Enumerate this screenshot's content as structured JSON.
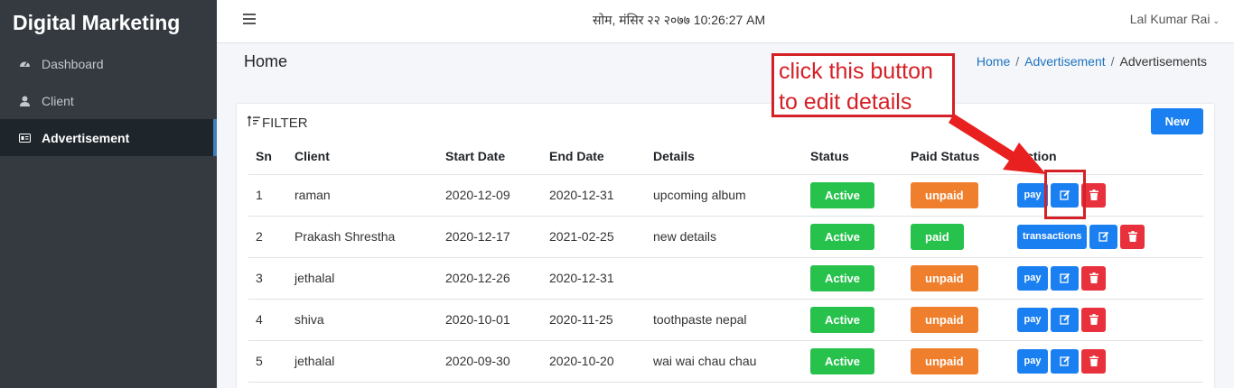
{
  "sidebar": {
    "brand": "Digital Marketing",
    "items": [
      {
        "label": "Dashboard",
        "icon": "dashboard-icon"
      },
      {
        "label": "Client",
        "icon": "user-icon"
      },
      {
        "label": "Advertisement",
        "icon": "ad-icon",
        "active": true
      }
    ]
  },
  "topbar": {
    "datetime": "सोम, मंसिर २२ २०७७ 10:26:27 AM",
    "user": "Lal Kumar Rai"
  },
  "page": {
    "title": "Home",
    "breadcrumb": [
      "Home",
      "Advertisement",
      "Advertisements"
    ]
  },
  "card": {
    "filter_label": "FILTER",
    "new_button": "New"
  },
  "table": {
    "headers": [
      "Sn",
      "Client",
      "Start Date",
      "End Date",
      "Details",
      "Status",
      "Paid Status",
      "Action"
    ],
    "rows": [
      {
        "sn": "1",
        "client": "raman",
        "start": "2020-12-09",
        "end": "2020-12-31",
        "details": "upcoming album",
        "status": "Active",
        "paid": "unpaid",
        "primary_action": "pay"
      },
      {
        "sn": "2",
        "client": "Prakash Shrestha",
        "start": "2020-12-17",
        "end": "2021-02-25",
        "details": "new details",
        "status": "Active",
        "paid": "paid",
        "primary_action": "transactions"
      },
      {
        "sn": "3",
        "client": "jethalal",
        "start": "2020-12-26",
        "end": "2020-12-31",
        "details": "",
        "status": "Active",
        "paid": "unpaid",
        "primary_action": "pay"
      },
      {
        "sn": "4",
        "client": "shiva",
        "start": "2020-10-01",
        "end": "2020-11-25",
        "details": "toothpaste nepal",
        "status": "Active",
        "paid": "unpaid",
        "primary_action": "pay"
      },
      {
        "sn": "5",
        "client": "jethalal",
        "start": "2020-09-30",
        "end": "2020-10-20",
        "details": "wai wai chau chau",
        "status": "Active",
        "paid": "unpaid",
        "primary_action": "pay"
      }
    ]
  },
  "annotation": {
    "line1": "click this button",
    "line2": "to edit details"
  },
  "colors": {
    "primary": "#1a7ff0",
    "success": "#27c24c",
    "warning": "#f07f2d",
    "danger": "#e8313c",
    "annotation": "#d42027",
    "sidebar": "#343a40"
  }
}
